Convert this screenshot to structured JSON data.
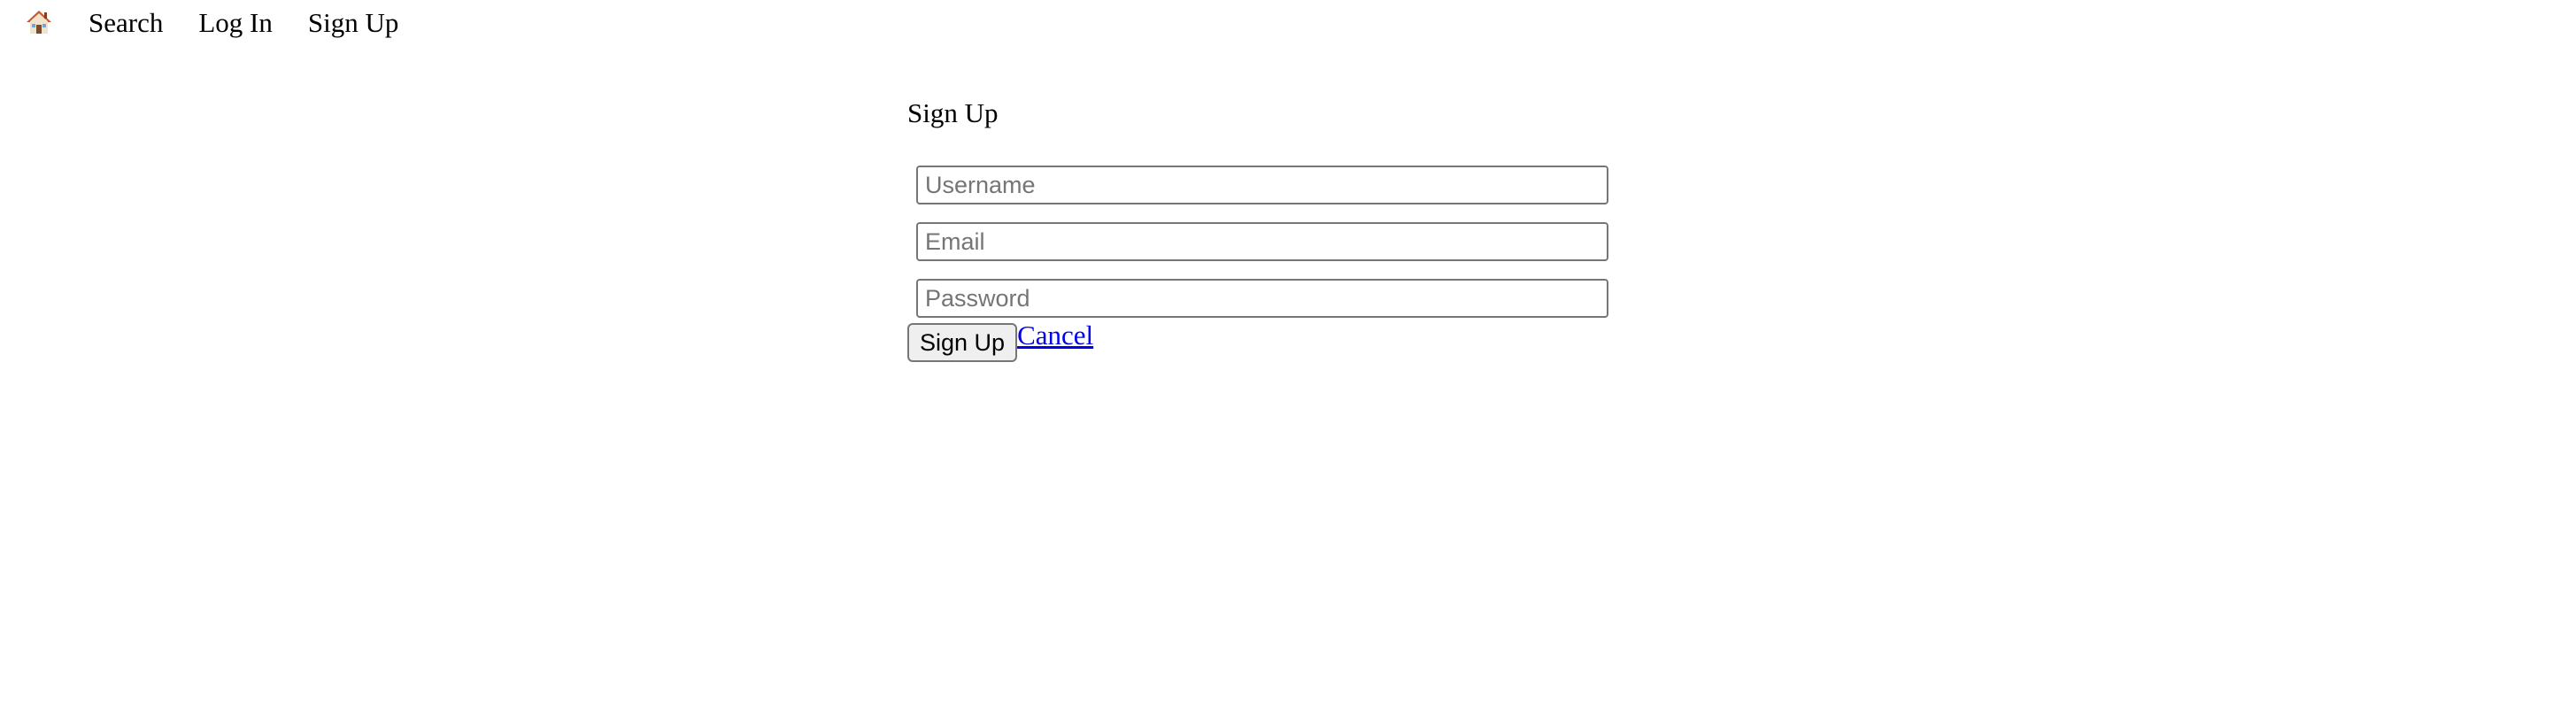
{
  "nav": {
    "home_icon": "house-icon",
    "items": [
      {
        "label": "Search"
      },
      {
        "label": "Log In"
      },
      {
        "label": "Sign Up"
      }
    ]
  },
  "signup": {
    "title": "Sign Up",
    "fields": {
      "username": {
        "value": "",
        "placeholder": "Username"
      },
      "email": {
        "value": "",
        "placeholder": "Email"
      },
      "password": {
        "value": "",
        "placeholder": "Password"
      }
    },
    "submit_label": "Sign Up",
    "cancel_label": "Cancel"
  },
  "colors": {
    "link": "#0000ee",
    "button_bg": "#efefef",
    "border": "#767676"
  }
}
